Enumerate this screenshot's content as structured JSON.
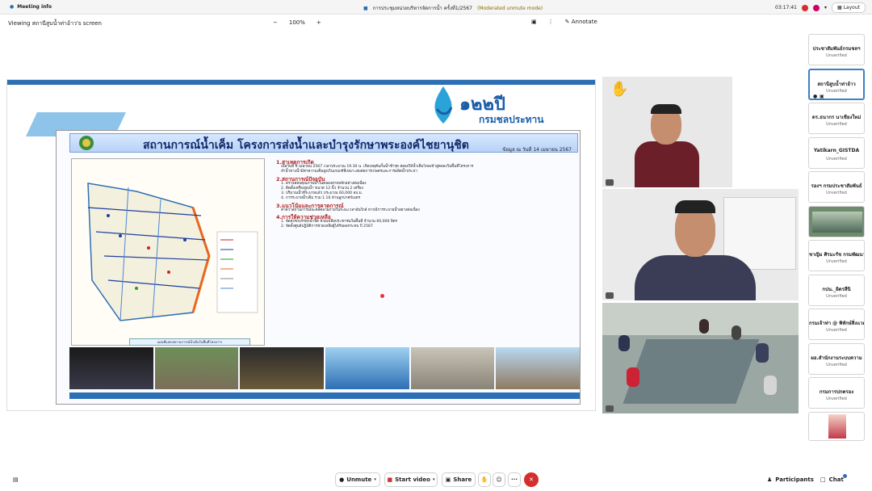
{
  "titlebar": {
    "app": "Meeting info",
    "meeting_title": "การประชุมหน่วยบริหารจัดการน้ำ ครั้งที่1/2567",
    "mode": "(Moderated unmute mode)",
    "time": "03:17:41",
    "layout_label": "Layout"
  },
  "viewbar": {
    "viewing": "Viewing สถานีสูบน้ำท่าอ้าว's screen",
    "zoom_out": "−",
    "zoom": "100%",
    "zoom_in": "+",
    "annotate": "Annotate"
  },
  "slide": {
    "logo_year": "๑๒๒ปี",
    "logo_dept": "กรมชลประทาน",
    "title": "สถานการณ์น้ำเค็ม โครงการส่งน้ำและบำรุงรักษาพระองค์ไชยานุชิต",
    "dateline": "ข้อมูล ณ วันที่ 14 เมษายน 2567",
    "map_caption": "แผนที่แสดงสถานการณ์น้ำเค็มในพื้นที่โครงการ",
    "sections": [
      {
        "heading": "1.สาเหตุการเกิด",
        "lines": [
          "เมื่อวันที่ 9 เมษายน 2567 เวลาประมาณ 19.30 น. เกิดเหตุคันกั้นน้ำชำรุด ส่งผลให้น้ำเค็มไหลเข้าสู่คลองในพื้นที่โครงการ",
          "ลำน้ำทางน้ำมีค่าความเค็มสูงเกินเกณฑ์ที่เหมาะสมต่อการเกษตรและการผลิตน้ำประปา"
        ]
      },
      {
        "heading": "2.สถานการณ์ปัจจุบัน",
        "lines": [
          "1. ตรวจสอบคุณภาพน้ำในคลองสายหลักอย่างต่อเนื่อง",
          "2. ติดตั้งเครื่องสูบน้ำ ขนาด 12 นิ้ว จำนวน 2 เครื่อง",
          "3. ปริมาณน้ำที่ระบายแล้ว ประมาณ 60,000 ลบ.ม.",
          "4. การระบายน้ำเค็ม รวม 1.16 ล้านลูกบาศก์เมตร"
        ]
      },
      {
        "heading": "3.แนวโน้มและการคาดการณ์",
        "lines": [
          "คาดว่าสถานการณ์จะคลี่คลายภายในระยะเวลาอันใกล้ หากมีการระบายน้ำอย่างต่อเนื่อง"
        ]
      },
      {
        "heading": "4.การให้ความช่วยเหลือ",
        "lines": [
          "1. จัดส่งรถบรรทุกน้ำจืด ช่วยเหลือประชาชนในพื้นที่ จำนวน 60,000 ลิตร",
          "2. จัดตั้งศูนย์ปฏิบัติการช่วยเหลือผู้ได้รับผลกระทบ ปี 2567"
        ]
      }
    ]
  },
  "roster": [
    {
      "name": "ประชาสัมพันธ์กรมชลฯ",
      "status": "Unverified",
      "active": false
    },
    {
      "name": "สถานีสูบน้ำท่าอ้าว",
      "status": "Unverified",
      "active": true
    },
    {
      "name": "ดร.ธนากร นาเชียงใหม่",
      "status": "Unverified",
      "active": false
    },
    {
      "name": "Yatikarn_GISTDA",
      "status": "Unverified",
      "active": false
    },
    {
      "name": "รองฯ กรมประชาสัมพันธ์",
      "status": "Unverified",
      "active": false
    },
    {
      "name": "",
      "status": "",
      "active": false,
      "image": true
    },
    {
      "name": "ชาญิม ศิรมะรัช กรมพัฒนา",
      "status": "Unverified",
      "active": false
    },
    {
      "name": "กปน._ผิดรสีนิ",
      "status": "Unverified",
      "active": false
    },
    {
      "name": "กรมเจ้าท่า @ พิทักษ์สิ่งแวดล้อม",
      "status": "Unverified",
      "active": false
    },
    {
      "name": "ผอ.สำนักงานระบบความ",
      "status": "Unverified",
      "active": false
    },
    {
      "name": "กรมการปกครอง",
      "status": "Unverified",
      "active": false
    }
  ],
  "bottombar": {
    "unmute": "Unmute",
    "start_video": "Start video",
    "share": "Share",
    "more": "···",
    "participants": "Participants",
    "chat": "Chat"
  },
  "colors": {
    "accent": "#2d6fb4",
    "end_call": "#d32f2f",
    "raised_hand": "#f1b81c",
    "active_tile": "#3b82c4"
  }
}
